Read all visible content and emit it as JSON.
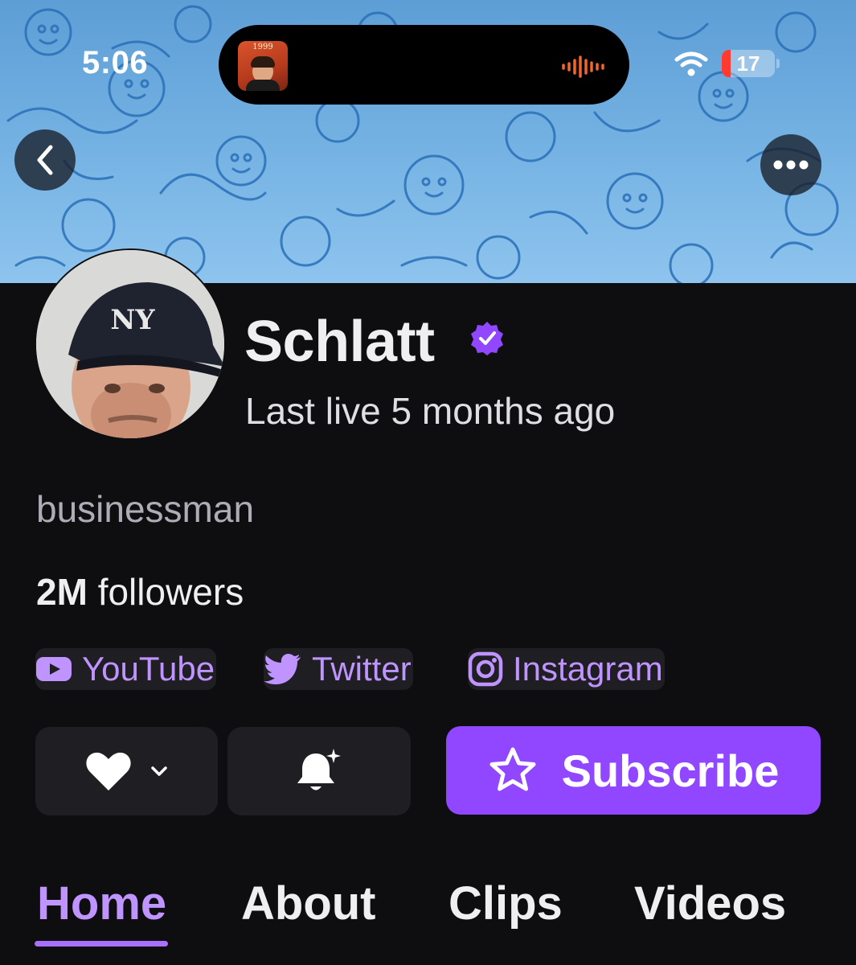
{
  "status_bar": {
    "time": "5:06",
    "album_art_text": "1999",
    "battery_level": "17"
  },
  "profile": {
    "name": "Schlatt",
    "last_live": "Last live 5 months ago",
    "bio": "businessman",
    "followers_count": "2M",
    "followers_label": "followers"
  },
  "social_links": [
    {
      "label": "YouTube",
      "icon": "youtube-icon"
    },
    {
      "label": "Twitter",
      "icon": "twitter-icon"
    },
    {
      "label": "Instagram",
      "icon": "instagram-icon"
    }
  ],
  "actions": {
    "follow_icon": "heart-icon",
    "notify_icon": "bell-sparkle-icon",
    "subscribe_label": "Subscribe",
    "subscribe_icon": "star-icon"
  },
  "tabs": [
    {
      "label": "Home",
      "active": true
    },
    {
      "label": "About",
      "active": false
    },
    {
      "label": "Clips",
      "active": false
    },
    {
      "label": "Videos",
      "active": false
    }
  ],
  "colors": {
    "background": "#0e0e10",
    "accent": "#9147ff",
    "accent_text": "#bf94ff",
    "surface": "#1f1f23",
    "banner": "#76b3e4"
  }
}
